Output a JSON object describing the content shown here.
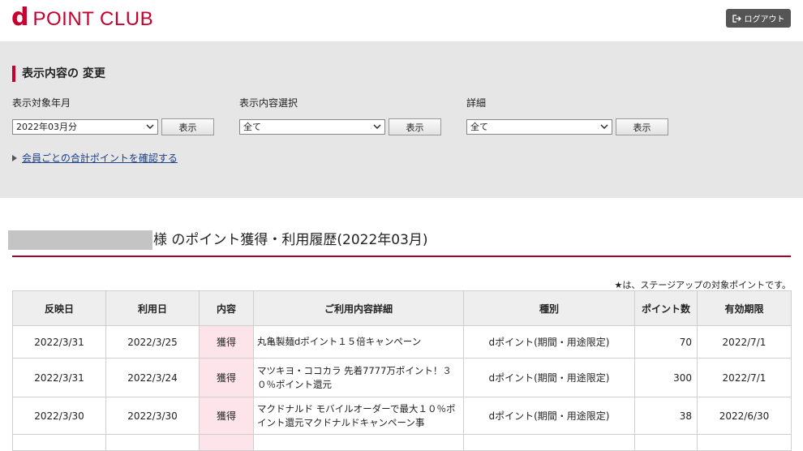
{
  "header": {
    "logo_mark": "d",
    "logo_text": "POINT CLUB",
    "logout_label": "ログアウト",
    "brand_color": "#c6002e"
  },
  "filter": {
    "title": "表示内容の 変更",
    "month_label": "表示対象年月",
    "month_value": "2022年03月分",
    "content_label": "表示内容選択",
    "content_value": "全て",
    "detail_label": "詳細",
    "detail_value": "全て",
    "show_button": "表示",
    "totals_link": "会員ごとの合計ポイントを確認する"
  },
  "history": {
    "title": "様 のポイント獲得・利用履歴(2022年03月)",
    "note": "★は、ステージアップの対象ポイントです。",
    "columns": [
      "反映日",
      "利用日",
      "内容",
      "ご利用内容詳細",
      "種別",
      "ポイント数",
      "有効期限"
    ],
    "rows": [
      {
        "reflect": "2022/3/31",
        "use": "2022/3/25",
        "kind": "獲得",
        "detail": "丸亀製麺dポイント１５倍キャンペーン",
        "type": "dポイント(期間・用途限定)",
        "points": "70",
        "expiry": "2022/7/1"
      },
      {
        "reflect": "2022/3/31",
        "use": "2022/3/24",
        "kind": "獲得",
        "detail": "マツキヨ・ココカラ 先着7777万ポイント！３０％ポイント還元",
        "type": "dポイント(期間・用途限定)",
        "points": "300",
        "expiry": "2022/7/1"
      },
      {
        "reflect": "2022/3/30",
        "use": "2022/3/30",
        "kind": "獲得",
        "detail": "マクドナルド モバイルオーダーで最大１０％ポイント還元マクドナルドキャンペーン事",
        "type": "dポイント(期間・用途限定)",
        "points": "38",
        "expiry": "2022/6/30"
      }
    ]
  }
}
